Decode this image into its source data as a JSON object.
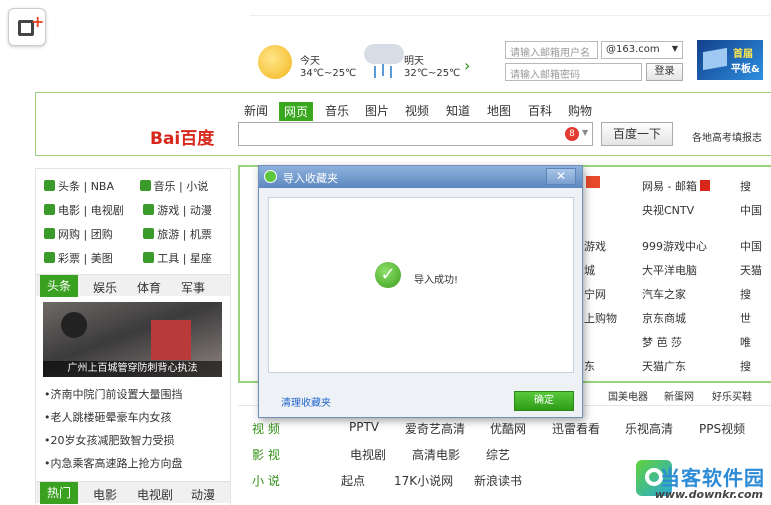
{
  "weather": {
    "today_label": "今天",
    "today_temp": "34℃~25℃",
    "tomorrow_label": "明天",
    "tomorrow_temp": "32℃~25℃",
    "next_icon": "›"
  },
  "login": {
    "user_placeholder": "请输入邮箱用户名",
    "domain_value": "@163.com",
    "password_placeholder": "请输入邮箱密码",
    "login_button": "登录"
  },
  "ad": {
    "text_line1": "首届",
    "text_line2": "平板&"
  },
  "search": {
    "tabs": [
      "新闻",
      "网页",
      "音乐",
      "图片",
      "视频",
      "知道",
      "地图",
      "百科",
      "购物"
    ],
    "active_tab": "网页",
    "logo_text": "Bai百度",
    "badge_count": "8",
    "button_label": "百度一下",
    "side_text": "各地高考填报志"
  },
  "left_nav": {
    "rows": [
      [
        "头条",
        "NBA",
        "音乐",
        "小说"
      ],
      [
        "电影",
        "电视剧",
        "游戏",
        "动漫"
      ],
      [
        "网购",
        "团购",
        "旅游",
        "机票"
      ],
      [
        "彩票",
        "美图",
        "工具",
        "星座"
      ]
    ],
    "news_tabs": [
      "头条",
      "娱乐",
      "体育",
      "军事"
    ],
    "photo_caption": "广州上百城管穿防刺背心执法",
    "news_items": [
      "•济南中院门前设置大量围挡",
      "•老人跳楼砸晕豪车内女孩",
      "•20岁女孩减肥致智力受损",
      "•内急乘客高速路上抢方向盘"
    ],
    "bottom_tabs": [
      "热门",
      "电影",
      "电视剧",
      "动漫"
    ]
  },
  "right_cols": {
    "col1": [
      "游戏",
      "城",
      "宁网",
      "上购物",
      "",
      "东"
    ],
    "col2": [
      "网易 - 邮箱",
      "央视CNTV",
      "999游戏中心",
      "大平洋电脑",
      "汽车之家",
      "京东商城",
      "梦 芭 莎",
      "天猫广东"
    ],
    "col3": [
      "搜",
      "中国",
      "中国",
      "天猫",
      "搜",
      "世",
      "唯",
      "搜"
    ],
    "links_row": [
      "国美电器",
      "新蛋网",
      "好乐买鞋"
    ]
  },
  "dialog": {
    "title": "导入收藏夹",
    "close": "✕",
    "message": "导入成功!",
    "clean_link": "清理收藏夹",
    "ok_button": "确定"
  },
  "categories": {
    "video": {
      "label": "视 频",
      "items": [
        "PPTV",
        "爱奇艺高清",
        "优酷网",
        "迅雷看看",
        "乐视高清",
        "PPS视频"
      ]
    },
    "film": {
      "label": "影 视",
      "items": [
        "电视剧",
        "高清电影",
        "综艺",
        "",
        "",
        ""
      ]
    },
    "novel": {
      "label": "小 说",
      "items": [
        "起点",
        "17K小说网",
        "新浪读书"
      ]
    }
  },
  "watermark": {
    "text": "当客软件园",
    "url": "www.downkr.com"
  },
  "colors": {
    "green": "#38a81e",
    "dialog_blue": "#5c87bf",
    "watermark_blue": "#2e8bd6"
  }
}
